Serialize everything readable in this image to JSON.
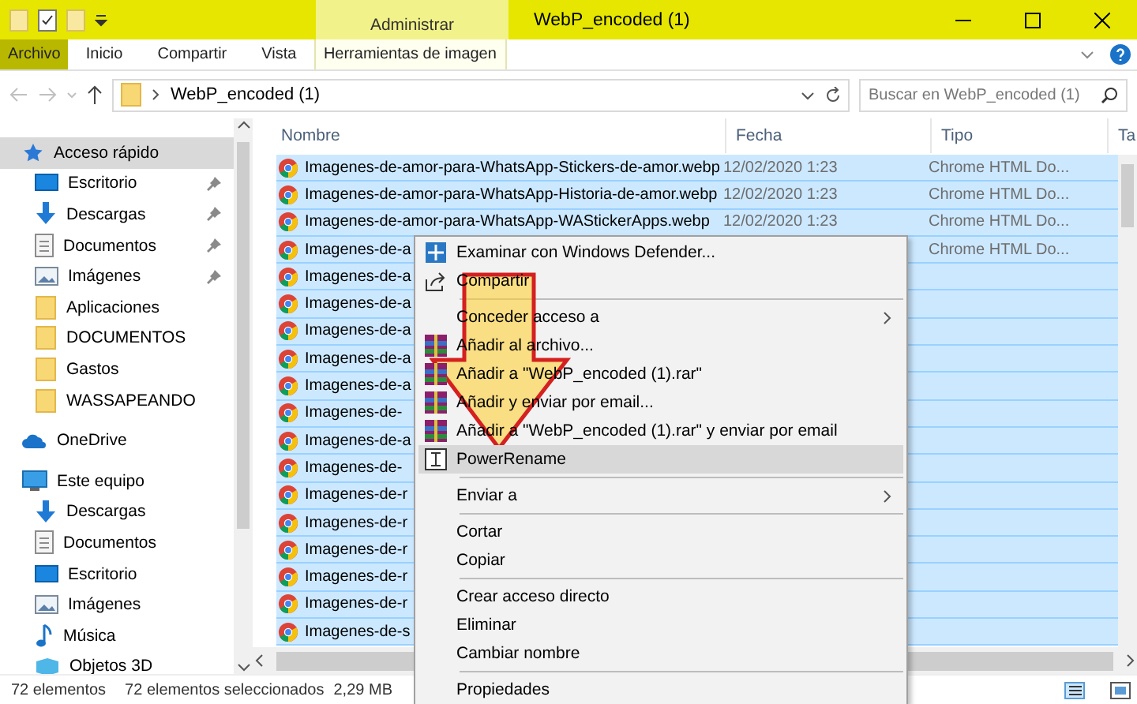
{
  "title_bar": {
    "context_tab": "Administrar",
    "title": "WebP_encoded (1)"
  },
  "ribbon_tabs": [
    {
      "label": "Archivo",
      "selected": true
    },
    {
      "label": "Inicio",
      "selected": false
    },
    {
      "label": "Compartir",
      "selected": false
    },
    {
      "label": "Vista",
      "selected": false
    },
    {
      "label": "Herramientas de imagen",
      "selected": false
    }
  ],
  "address_bar": {
    "path": "WebP_encoded (1)",
    "search_placeholder": "Buscar en WebP_encoded (1)"
  },
  "sidebar": {
    "items": [
      {
        "label": "Acceso rápido",
        "kind": "star",
        "selected": true,
        "children": [
          {
            "label": "Escritorio",
            "kind": "desktop",
            "pinned": true,
            "selected": false
          },
          {
            "label": "Descargas",
            "kind": "download",
            "pinned": true,
            "selected": false
          },
          {
            "label": "Documentos",
            "kind": "document",
            "pinned": true,
            "selected": false
          },
          {
            "label": "Imágenes",
            "kind": "picture",
            "pinned": true,
            "selected": false
          },
          {
            "label": "Aplicaciones",
            "kind": "folder",
            "pinned": false,
            "selected": false
          },
          {
            "label": "DOCUMENTOS",
            "kind": "folder",
            "pinned": false,
            "selected": false
          },
          {
            "label": "Gastos",
            "kind": "folder",
            "pinned": false,
            "selected": false
          },
          {
            "label": "WASSAPEANDO",
            "kind": "folder",
            "pinned": false,
            "selected": false
          }
        ]
      },
      {
        "label": "OneDrive",
        "kind": "cloud",
        "selected": false
      },
      {
        "label": "Este equipo",
        "kind": "computer",
        "selected": false,
        "children": [
          {
            "label": "Descargas",
            "kind": "download",
            "pinned": false,
            "selected": false
          },
          {
            "label": "Documentos",
            "kind": "document",
            "pinned": false,
            "selected": false
          },
          {
            "label": "Escritorio",
            "kind": "desktop",
            "pinned": false,
            "selected": false
          },
          {
            "label": "Imágenes",
            "kind": "picture",
            "pinned": false,
            "selected": false
          },
          {
            "label": "Música",
            "kind": "music",
            "pinned": false,
            "selected": false
          },
          {
            "label": "Objetos 3D",
            "kind": "cube",
            "pinned": false,
            "selected": false
          }
        ]
      }
    ]
  },
  "table": {
    "columns": [
      "Nombre",
      "Fecha",
      "Tipo",
      "Ta"
    ],
    "rows": [
      {
        "name": "Imagenes-de-amor-para-WhatsApp-Stickers-de-amor.webp",
        "date": "12/02/2020 1:23",
        "type": "Chrome HTML Do...",
        "selected": true
      },
      {
        "name": "Imagenes-de-amor-para-WhatsApp-Historia-de-amor.webp",
        "date": "12/02/2020 1:23",
        "type": "Chrome HTML Do...",
        "selected": true
      },
      {
        "name": "Imagenes-de-amor-para-WhatsApp-WAStickerApps.webp",
        "date": "12/02/2020 1:23",
        "type": "Chrome HTML Do...",
        "selected": true
      },
      {
        "name": "Imagenes-de-a",
        "type": "Chrome HTML Do...",
        "selected": true
      },
      {
        "name": "Imagenes-de-a",
        "selected": true
      },
      {
        "name": "Imagenes-de-a",
        "selected": true
      },
      {
        "name": "Imagenes-de-a",
        "selected": true
      },
      {
        "name": "Imagenes-de-a",
        "selected": true
      },
      {
        "name": "Imagenes-de-a",
        "selected": true
      },
      {
        "name": "Imagenes-de-",
        "selected": true
      },
      {
        "name": "Imagenes-de-a",
        "selected": true
      },
      {
        "name": "Imagenes-de-",
        "selected": true
      },
      {
        "name": "Imagenes-de-r",
        "selected": true
      },
      {
        "name": "Imagenes-de-r",
        "selected": true
      },
      {
        "name": "Imagenes-de-r",
        "selected": true
      },
      {
        "name": "Imagenes-de-r",
        "selected": true
      },
      {
        "name": "Imagenes-de-r",
        "selected": true
      },
      {
        "name": "Imagenes-de-s",
        "selected": true
      }
    ]
  },
  "context_menu": {
    "items": [
      {
        "kind": "shield",
        "label": "Examinar con Windows Defender...",
        "submenu": false,
        "selected": false
      },
      {
        "kind": "share",
        "label": "Compartir",
        "submenu": false,
        "selected": false
      },
      {
        "kind": "separator"
      },
      {
        "kind": "plain",
        "label": "Conceder acceso a",
        "submenu": true,
        "selected": false
      },
      {
        "kind": "archive",
        "label": "Añadir al archivo...",
        "submenu": false,
        "selected": false
      },
      {
        "kind": "archive",
        "label": "Añadir a \"WebP_encoded (1).rar\"",
        "submenu": false,
        "selected": false
      },
      {
        "kind": "archive",
        "label": "Añadir y enviar por email...",
        "submenu": false,
        "selected": false
      },
      {
        "kind": "archive",
        "label": "Añadir a \"WebP_encoded (1).rar\" y enviar por email",
        "submenu": false,
        "selected": false
      },
      {
        "kind": "rename",
        "label": "PowerRename",
        "submenu": false,
        "selected": true
      },
      {
        "kind": "separator"
      },
      {
        "kind": "plain",
        "label": "Enviar a",
        "submenu": true,
        "selected": false
      },
      {
        "kind": "separator"
      },
      {
        "kind": "plain",
        "label": "Cortar",
        "submenu": false,
        "selected": false
      },
      {
        "kind": "plain",
        "label": "Copiar",
        "submenu": false,
        "selected": false
      },
      {
        "kind": "separator"
      },
      {
        "kind": "plain",
        "label": "Crear acceso directo",
        "submenu": false,
        "selected": false
      },
      {
        "kind": "plain",
        "label": "Eliminar",
        "submenu": false,
        "selected": false
      },
      {
        "kind": "plain",
        "label": "Cambiar nombre",
        "submenu": false,
        "selected": false
      },
      {
        "kind": "separator"
      },
      {
        "kind": "plain",
        "label": "Propiedades",
        "submenu": false,
        "selected": false
      }
    ]
  },
  "status_bar": {
    "count": "72 elementos",
    "selection": "72 elementos seleccionados",
    "size": "2,29 MB"
  }
}
